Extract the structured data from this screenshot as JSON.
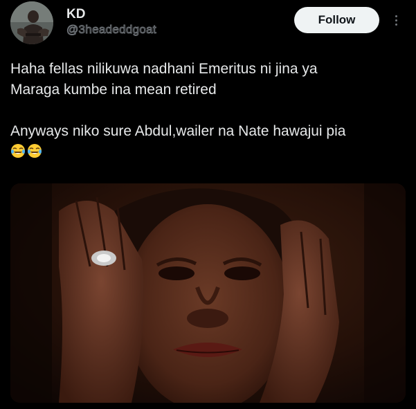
{
  "author": {
    "display_name": "KD",
    "handle": "@3headeddgoat",
    "avatar_icon": "user-avatar"
  },
  "actions": {
    "follow_label": "Follow",
    "more_icon": "more-vertical-icon"
  },
  "tweet": {
    "paragraph_1_line_1": "Haha fellas nilikuwa nadhani Emeritus ni jina ya",
    "paragraph_1_line_2": "Maraga kumbe ina mean retired",
    "paragraph_2": "Anyways niko sure Abdul,wailer na Nate hawajui pia",
    "emojis": [
      "😂",
      "😂"
    ]
  },
  "colors": {
    "background": "#000000",
    "text_primary": "#e7e9ea",
    "text_secondary": "#71767b",
    "follow_bg": "#eff3f4",
    "follow_text": "#0f1419"
  }
}
